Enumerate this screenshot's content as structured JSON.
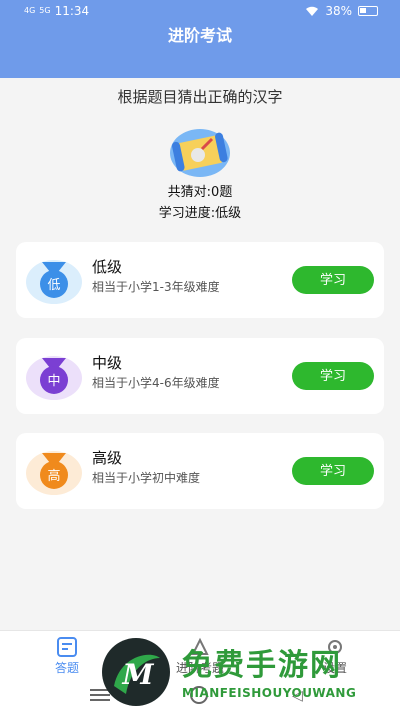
{
  "status_bar": {
    "network": "4G",
    "network2": "5G",
    "time": "11:34",
    "battery": "38%"
  },
  "header": {
    "title": "进阶考试"
  },
  "main": {
    "subtitle": "根据题目猜出正确的汉字",
    "correct_count": "共猜对:0题",
    "progress": "学习进度:低级",
    "levels": [
      {
        "badge": "低",
        "name": "低级",
        "desc": "相当于小学1-3年级难度",
        "button": "学习",
        "color": "#3c8fe8",
        "bg": "#dbeefc"
      },
      {
        "badge": "中",
        "name": "中级",
        "desc": "相当于小学4-6年级难度",
        "button": "学习",
        "color": "#7b3fd3",
        "bg": "#ece0fa"
      },
      {
        "badge": "高",
        "name": "高级",
        "desc": "相当于小学初中难度",
        "button": "学习",
        "color": "#f08a1c",
        "bg": "#fdebd6"
      }
    ]
  },
  "tabbar": {
    "tabs": [
      {
        "label": "答题",
        "icon": "quiz-icon"
      },
      {
        "label": "进阶考题",
        "icon": "advanced-icon"
      },
      {
        "label": "设置",
        "icon": "gear-icon"
      }
    ]
  },
  "watermark": {
    "brand_cn": "免费手游网",
    "brand_en": "MIANFEISHOUYOUWANG"
  },
  "colors": {
    "header": "#6f9bea",
    "accent": "#2eb82e",
    "tab_active": "#4a8cf0"
  }
}
